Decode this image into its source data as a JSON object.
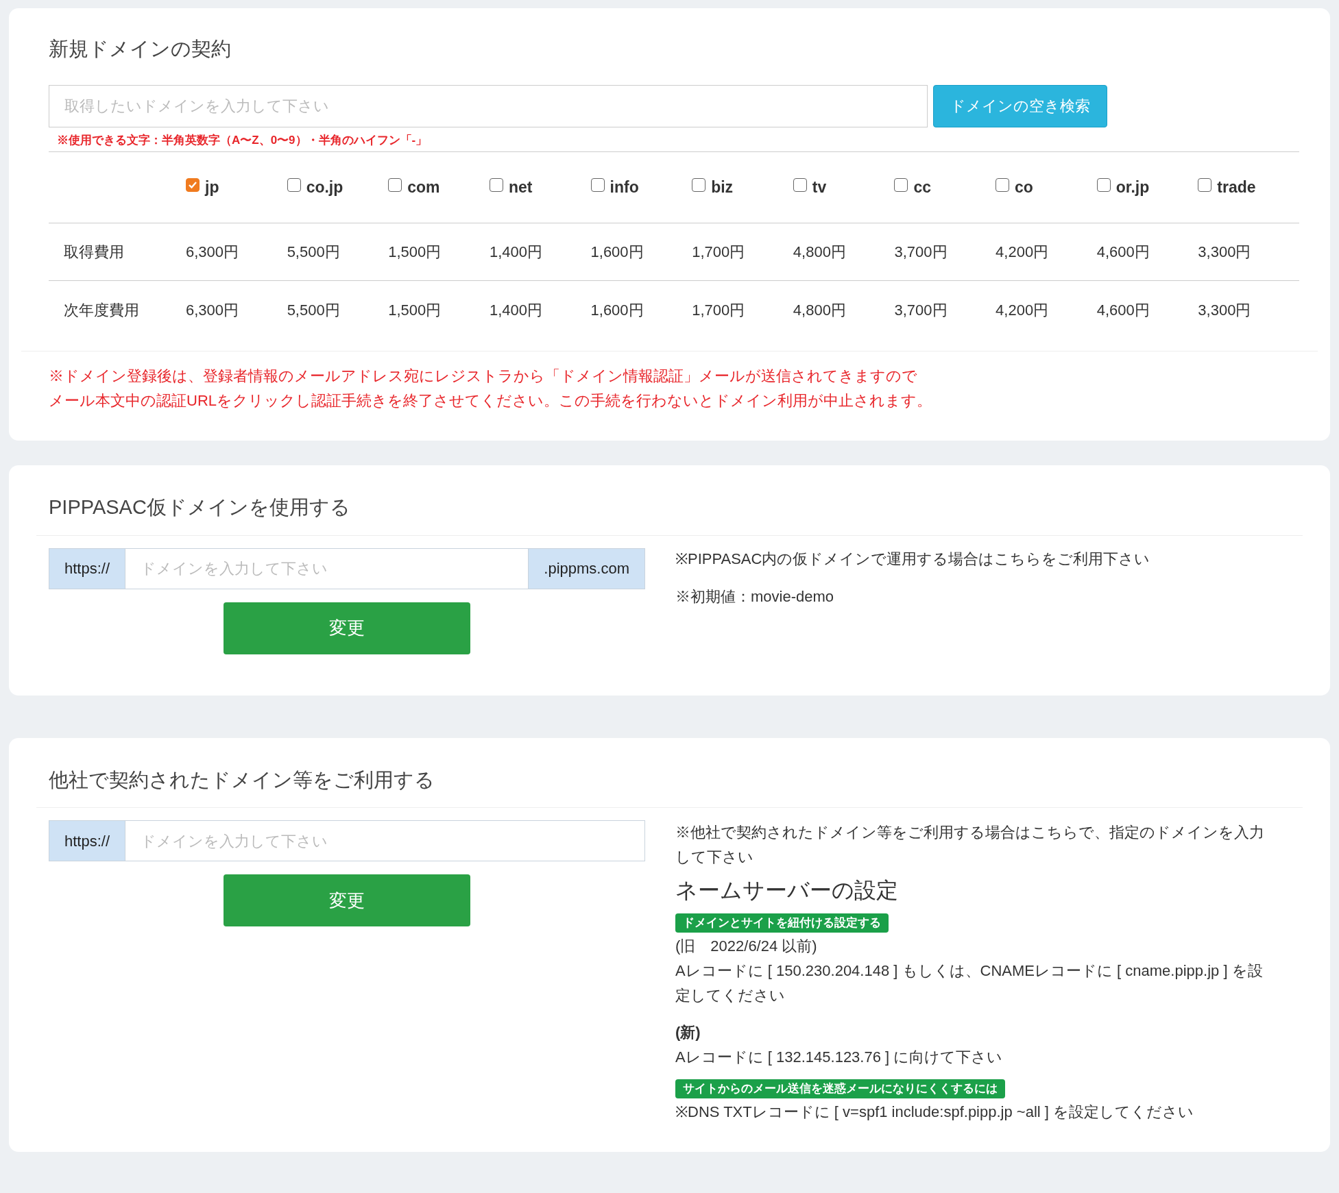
{
  "new_domain": {
    "title": "新規ドメインの契約",
    "search": {
      "placeholder": "取得したいドメインを入力して下さい"
    },
    "search_button": "ドメインの空き検索",
    "hint": "※使用できる文字：半角英数字（A〜Z、0〜9）・半角のハイフン「-」",
    "tlds": [
      {
        "label": "jp",
        "checked": true
      },
      {
        "label": "co.jp",
        "checked": false
      },
      {
        "label": "com",
        "checked": false
      },
      {
        "label": "net",
        "checked": false
      },
      {
        "label": "info",
        "checked": false
      },
      {
        "label": "biz",
        "checked": false
      },
      {
        "label": "tv",
        "checked": false
      },
      {
        "label": "cc",
        "checked": false
      },
      {
        "label": "co",
        "checked": false
      },
      {
        "label": "or.jp",
        "checked": false
      },
      {
        "label": "trade",
        "checked": false
      }
    ],
    "rows": [
      {
        "label": "取得費用",
        "prices": [
          "6,300円",
          "5,500円",
          "1,500円",
          "1,400円",
          "1,600円",
          "1,700円",
          "4,800円",
          "3,700円",
          "4,200円",
          "4,600円",
          "3,300円"
        ]
      },
      {
        "label": "次年度費用",
        "prices": [
          "6,300円",
          "5,500円",
          "1,500円",
          "1,400円",
          "1,600円",
          "1,700円",
          "4,800円",
          "3,700円",
          "4,200円",
          "4,600円",
          "3,300円"
        ]
      }
    ],
    "notice": [
      "※ドメイン登録後は、登録者情報のメールアドレス宛にレジストラから「ドメイン情報認証」メールが送信されてきますので",
      "メール本文中の認証URLをクリックし認証手続きを終了させてください。この手続を行わないとドメイン利用が中止されます。"
    ]
  },
  "temp_domain": {
    "title": "PIPPASAC仮ドメインを使用する",
    "prefix": "https://",
    "placeholder": "ドメインを入力して下さい",
    "suffix": ".pippms.com",
    "button": "変更",
    "notes": [
      "※PIPPASAC内の仮ドメインで運用する場合はこちらをご利用下さい",
      "※初期値：movie-demo"
    ]
  },
  "external_domain": {
    "title": "他社で契約されたドメイン等をご利用する",
    "prefix": "https://",
    "placeholder": "ドメインを入力して下さい",
    "button": "変更",
    "blocks": [
      {
        "kind": "note",
        "text": "※他社で契約されたドメイン等をご利用する場合はこちらで、指定のドメインを入力して下さい"
      },
      {
        "kind": "heading",
        "text": "ネームサーバーの設定"
      },
      {
        "kind": "badge",
        "text": "ドメインとサイトを紐付ける設定する"
      },
      {
        "kind": "text",
        "text": "(旧　2022/6/24 以前)"
      },
      {
        "kind": "text",
        "text": "Aレコードに [ 150.230.204.148 ] もしくは、CNAMEレコードに [ cname.pipp.jp ] を設定してください"
      },
      {
        "kind": "bold",
        "text": "(新)"
      },
      {
        "kind": "text",
        "text": "Aレコードに [ 132.145.123.76 ] に向けて下さい"
      },
      {
        "kind": "badge",
        "text": "サイトからのメール送信を迷惑メールになりにくくするには"
      },
      {
        "kind": "text",
        "text": "※DNS TXTレコードに [ v=spf1 include:spf.pipp.jp ~all ] を設定してください"
      }
    ]
  }
}
